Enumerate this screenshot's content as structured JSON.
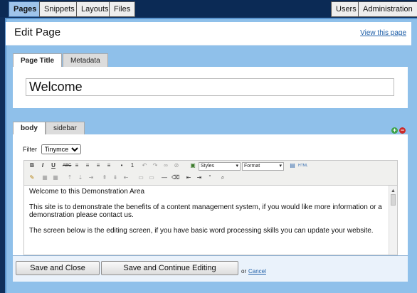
{
  "nav": {
    "tabs_left": [
      "Pages",
      "Snippets",
      "Layouts",
      "Files"
    ],
    "tabs_right": [
      "Users",
      "Administration"
    ],
    "active": "Pages"
  },
  "header": {
    "title": "Edit Page",
    "view_link": "View this page"
  },
  "title_tabs": [
    "Page Title",
    "Metadata"
  ],
  "page_title_value": "Welcome",
  "part_tabs": [
    "body",
    "sidebar"
  ],
  "filter": {
    "label": "Filter",
    "value": "Tinymce"
  },
  "toolbar": {
    "styles_label": "Styles",
    "format_label": "Format",
    "html_label": "HTML"
  },
  "content": {
    "lines": [
      "Welcome to this Demonstration Area",
      "This site is to demonstrate the benefits of a content management system, if you would like more information or a demonstration please contact us.",
      "The screen below is the editing screen, if you have basic word processing skills you can update your website."
    ]
  },
  "buttons": {
    "save_close": "Save and Close",
    "save_continue": "Save and Continue Editing",
    "or_text": "or",
    "cancel": "Cancel"
  },
  "colors": {
    "frame": "#8fc0ea",
    "nav_bg": "#0b2a55",
    "link": "#1f5fa8"
  }
}
